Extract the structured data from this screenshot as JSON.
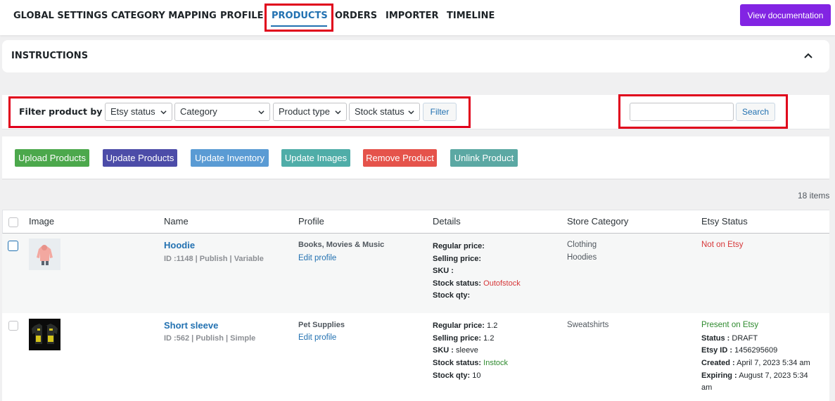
{
  "nav": {
    "tabs": [
      "GLOBAL SETTINGS",
      "CATEGORY MAPPING",
      "PROFILE",
      "PRODUCTS",
      "ORDERS",
      "IMPORTER",
      "TIMELINE"
    ],
    "active_tab": "PRODUCTS",
    "doc_button": "View documentation"
  },
  "instructions": {
    "title": "INSTRUCTIONS"
  },
  "filter": {
    "label": "Filter product by",
    "selects": [
      "Etsy status",
      "Category",
      "Product type",
      "Stock status"
    ],
    "filter_button": "Filter",
    "search_button": "Search",
    "search_value": ""
  },
  "actions": [
    "Upload Products",
    "Update Products",
    "Update Inventory",
    "Update Images",
    "Remove Product",
    "Unlink Product"
  ],
  "action_colors": [
    "#4ca84c",
    "#4c4ca8",
    "#5a9bd4",
    "#4fada8",
    "#e5534b",
    "#5ba8a3"
  ],
  "items_count": "18 items",
  "table": {
    "headers": [
      "Image",
      "Name",
      "Profile",
      "Details",
      "Store Category",
      "Etsy Status"
    ],
    "rows": [
      {
        "name": "Hoodie",
        "meta": "ID :1148 | Publish | Variable",
        "profile": "Books, Movies & Music",
        "edit_profile": "Edit profile",
        "details": {
          "regular_price_label": "Regular price:",
          "regular_price": "",
          "selling_price_label": "Selling price:",
          "selling_price": "",
          "sku_label": "SKU :",
          "sku": "",
          "stock_status_label": "Stock status:",
          "stock_status": "Outofstock",
          "stock_qty_label": "Stock qty:",
          "stock_qty": ""
        },
        "store_category": [
          "Clothing",
          "Hoodies"
        ],
        "etsy_status": "Not on Etsy"
      },
      {
        "name": "Short sleeve",
        "meta": "ID :562 | Publish | Simple",
        "profile": "Pet Supplies",
        "edit_profile": "Edit profile",
        "details": {
          "regular_price_label": "Regular price:",
          "regular_price": "1.2",
          "selling_price_label": "Selling price:",
          "selling_price": "1.2",
          "sku_label": "SKU :",
          "sku": "sleeve",
          "stock_status_label": "Stock status:",
          "stock_status": "Instock",
          "stock_qty_label": "Stock qty:",
          "stock_qty": "10"
        },
        "store_category": [
          "Sweatshirts"
        ],
        "etsy_status": "Present on Etsy",
        "etsy_details": {
          "status_label": "Status :",
          "status": "DRAFT",
          "etsy_id_label": "Etsy ID :",
          "etsy_id": "1456295609",
          "created_label": "Created :",
          "created": "April 7, 2023 5:34 am",
          "expiring_label": "Expiring :",
          "expiring_line1": "August 7, 2023 5:34",
          "expiring_line2": "am"
        }
      }
    ]
  }
}
